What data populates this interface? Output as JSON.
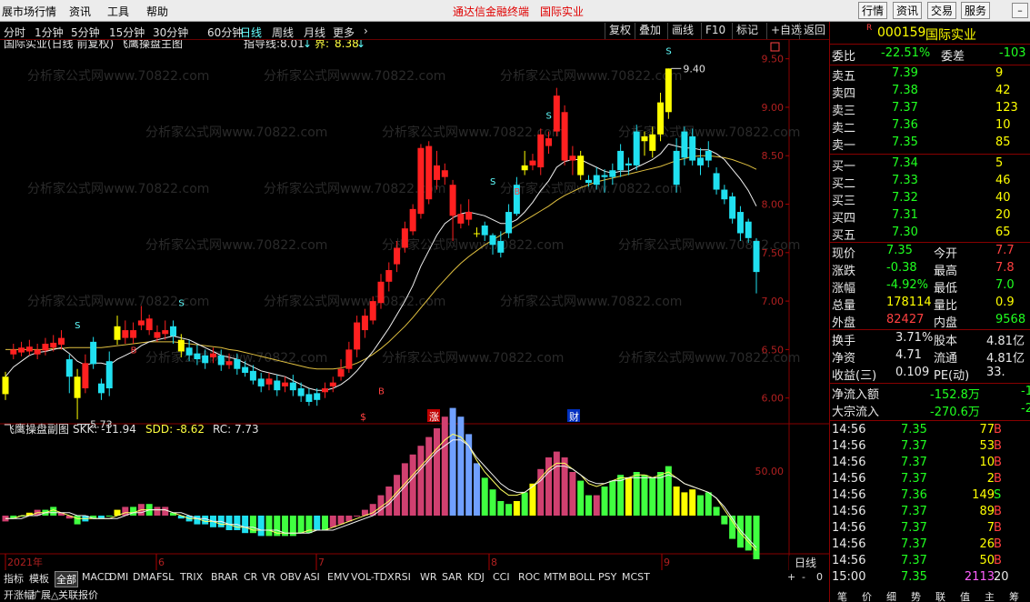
{
  "menubar": {
    "title": "展市场行情",
    "items": [
      "资讯",
      "工具",
      "帮助"
    ],
    "center": "通达信金融终端",
    "center_name": "国际实业",
    "right_buttons": [
      "行情",
      "资讯",
      "交易",
      "服务"
    ]
  },
  "periods": [
    "分时",
    "1分钟",
    "5分钟",
    "15分钟",
    "30分钟",
    "60分钟",
    "日线",
    "周线",
    "月线",
    "更多"
  ],
  "active_period": "日线",
  "tools": [
    "复权",
    "叠加",
    "画线",
    "F10",
    "标记",
    "+自选",
    "返回"
  ],
  "main": {
    "title": "国际实业(日线 前复权) 飞鹰操盘主图",
    "guide_label": "指导线:",
    "guide_value": "8.01",
    "bound_label": "界:",
    "bound_value": "8.38"
  },
  "sub": {
    "title": "飞鹰操盘副图",
    "skk": "SKK: -11.94",
    "sdd": "SDD: -8.62",
    "rc": "RC: 7.73",
    "level": "50.00"
  },
  "date_labels": [
    "2021年",
    "6",
    "7",
    "8",
    "9"
  ],
  "period_tag": "日线",
  "signals": [
    "$",
    "涨",
    "财"
  ],
  "markers": {
    "s": "S",
    "b": "B",
    "high": "9.40",
    "low": "5.73"
  },
  "watermark": "分析家公式网www.70822.com",
  "chart_data": {
    "type": "candlestick",
    "ylim": [
      5.8,
      9.6
    ],
    "yticks": [
      "9.50",
      "9.00",
      "8.50",
      "8.00",
      "7.50",
      "7.00",
      "6.50",
      "6.00"
    ],
    "high_label": 9.4,
    "low_label": 5.73,
    "candles": [
      [
        6.22,
        6.04,
        6.27,
        5.98,
        "y"
      ],
      [
        6.5,
        6.45,
        6.56,
        6.4,
        "r"
      ],
      [
        6.47,
        6.52,
        6.58,
        6.43,
        "r"
      ],
      [
        6.53,
        6.48,
        6.6,
        6.44,
        "r"
      ],
      [
        6.45,
        6.5,
        6.56,
        6.4,
        "r"
      ],
      [
        6.49,
        6.56,
        6.62,
        6.44,
        "r"
      ],
      [
        6.57,
        6.52,
        6.65,
        6.48,
        "r"
      ],
      [
        6.55,
        6.62,
        6.7,
        6.5,
        "r"
      ],
      [
        6.4,
        6.22,
        6.45,
        6.05,
        "c"
      ],
      [
        6.22,
        6.0,
        6.3,
        5.78,
        "y"
      ],
      [
        6.1,
        6.36,
        6.45,
        6.05,
        "r"
      ],
      [
        6.58,
        6.35,
        6.63,
        6.3,
        "c"
      ],
      [
        6.05,
        6.15,
        6.2,
        5.98,
        "c"
      ],
      [
        6.38,
        6.1,
        6.48,
        6.02,
        "c"
      ],
      [
        6.6,
        6.74,
        6.85,
        6.55,
        "y"
      ],
      [
        6.7,
        6.62,
        6.8,
        6.56,
        "r"
      ],
      [
        6.62,
        6.7,
        6.78,
        6.56,
        "r"
      ],
      [
        6.75,
        6.8,
        6.95,
        6.7,
        "r"
      ],
      [
        6.82,
        6.7,
        6.86,
        6.65,
        "r"
      ],
      [
        6.68,
        6.62,
        6.75,
        6.58,
        "r"
      ],
      [
        6.66,
        6.7,
        6.8,
        6.6,
        "r"
      ],
      [
        6.74,
        6.64,
        6.8,
        6.56,
        "c"
      ],
      [
        6.6,
        6.48,
        6.66,
        6.42,
        "y"
      ],
      [
        6.52,
        6.44,
        6.6,
        6.38,
        "c"
      ],
      [
        6.46,
        6.4,
        6.55,
        6.34,
        "c"
      ],
      [
        6.44,
        6.36,
        6.5,
        6.3,
        "c"
      ],
      [
        6.42,
        6.46,
        6.52,
        6.36,
        "r"
      ],
      [
        6.44,
        6.34,
        6.5,
        6.28,
        "c"
      ],
      [
        6.34,
        6.38,
        6.46,
        6.3,
        "r"
      ],
      [
        6.4,
        6.3,
        6.46,
        6.24,
        "c"
      ],
      [
        6.32,
        6.26,
        6.38,
        6.22,
        "c"
      ],
      [
        6.28,
        6.18,
        6.34,
        6.14,
        "c"
      ],
      [
        6.2,
        6.12,
        6.26,
        6.06,
        "c"
      ],
      [
        6.14,
        6.2,
        6.26,
        6.08,
        "r"
      ],
      [
        6.18,
        6.08,
        6.24,
        6.02,
        "c"
      ],
      [
        6.12,
        6.16,
        6.22,
        6.06,
        "r"
      ],
      [
        6.16,
        6.08,
        6.24,
        6.02,
        "c"
      ],
      [
        6.1,
        6.02,
        6.16,
        5.96,
        "c"
      ],
      [
        6.04,
        5.96,
        6.1,
        5.92,
        "c"
      ],
      [
        5.98,
        6.05,
        6.1,
        5.92,
        "c"
      ],
      [
        6.06,
        6.1,
        6.16,
        6.0,
        "r"
      ],
      [
        6.12,
        6.16,
        6.22,
        6.06,
        "r"
      ],
      [
        6.22,
        6.3,
        6.4,
        6.18,
        "r"
      ],
      [
        6.3,
        6.5,
        6.58,
        6.26,
        "r"
      ],
      [
        6.5,
        6.78,
        6.85,
        6.42,
        "r"
      ],
      [
        6.7,
        6.85,
        6.92,
        6.62,
        "r"
      ],
      [
        6.8,
        7.0,
        7.05,
        6.76,
        "r"
      ],
      [
        6.98,
        7.2,
        7.28,
        6.92,
        "r"
      ],
      [
        7.2,
        7.32,
        7.4,
        7.1,
        "r"
      ],
      [
        7.38,
        7.55,
        7.62,
        7.3,
        "r"
      ],
      [
        7.55,
        7.75,
        7.82,
        7.5,
        "r"
      ],
      [
        7.72,
        7.95,
        8.0,
        7.68,
        "r"
      ],
      [
        7.9,
        8.58,
        8.62,
        7.85,
        "r"
      ],
      [
        8.6,
        8.05,
        8.65,
        8.0,
        "r"
      ],
      [
        8.25,
        8.4,
        8.55,
        8.15,
        "r"
      ],
      [
        8.35,
        8.28,
        8.42,
        8.2,
        "r"
      ],
      [
        8.2,
        7.88,
        8.25,
        7.62,
        "r"
      ],
      [
        7.9,
        7.8,
        8.0,
        7.75,
        "r"
      ],
      [
        7.84,
        7.92,
        8.05,
        7.78,
        "r"
      ],
      [
        7.7,
        7.7,
        7.76,
        7.66,
        "y"
      ],
      [
        7.78,
        7.68,
        7.82,
        7.62,
        "c"
      ],
      [
        7.68,
        7.58,
        7.7,
        7.48,
        "c"
      ],
      [
        7.5,
        7.62,
        7.72,
        7.45,
        "c"
      ],
      [
        7.7,
        7.92,
        8.0,
        7.65,
        "c"
      ],
      [
        7.9,
        8.2,
        8.28,
        7.88,
        "c"
      ],
      [
        8.4,
        8.35,
        8.55,
        8.3,
        "y"
      ],
      [
        8.4,
        8.45,
        8.52,
        8.35,
        "r"
      ],
      [
        8.38,
        8.72,
        8.78,
        8.3,
        "r"
      ],
      [
        8.6,
        8.68,
        8.75,
        8.52,
        "r"
      ],
      [
        8.75,
        9.12,
        9.2,
        8.7,
        "r"
      ],
      [
        8.95,
        8.45,
        9.02,
        8.4,
        "r"
      ],
      [
        8.45,
        8.5,
        8.6,
        8.3,
        "r"
      ],
      [
        8.5,
        8.3,
        8.55,
        8.25,
        "y"
      ],
      [
        8.25,
        8.22,
        8.3,
        8.18,
        "c"
      ],
      [
        8.2,
        8.3,
        8.38,
        8.15,
        "c"
      ],
      [
        8.28,
        8.3,
        8.36,
        8.12,
        "c"
      ],
      [
        8.35,
        8.28,
        8.42,
        8.2,
        "c"
      ],
      [
        8.35,
        8.55,
        8.62,
        8.28,
        "c"
      ],
      [
        8.4,
        8.42,
        8.48,
        8.3,
        "c"
      ],
      [
        8.4,
        8.75,
        8.82,
        8.35,
        "c"
      ],
      [
        8.65,
        8.7,
        8.75,
        8.5,
        "y"
      ],
      [
        8.55,
        8.72,
        8.8,
        8.48,
        "y"
      ],
      [
        8.72,
        9.05,
        9.15,
        8.65,
        "y"
      ],
      [
        8.95,
        9.4,
        9.4,
        8.88,
        "y"
      ],
      [
        8.55,
        8.2,
        8.68,
        8.12,
        "c"
      ],
      [
        8.75,
        8.48,
        8.8,
        8.4,
        "c"
      ],
      [
        8.45,
        8.7,
        8.78,
        8.4,
        "c"
      ],
      [
        8.4,
        8.48,
        8.58,
        8.3,
        "c"
      ],
      [
        8.45,
        8.55,
        8.65,
        8.38,
        "c"
      ],
      [
        8.32,
        8.15,
        8.38,
        8.1,
        "c"
      ],
      [
        8.15,
        8.05,
        8.2,
        8.0,
        "c"
      ],
      [
        8.08,
        7.85,
        8.12,
        7.8,
        "c"
      ],
      [
        7.92,
        7.7,
        7.98,
        7.62,
        "c"
      ],
      [
        7.82,
        7.65,
        7.85,
        7.6,
        "c"
      ],
      [
        7.62,
        7.3,
        7.65,
        7.08,
        "c"
      ]
    ],
    "ma": [
      6.22,
      6.32,
      6.38,
      6.44,
      6.47,
      6.48,
      6.5,
      6.52,
      6.46,
      6.38,
      6.34,
      6.36,
      6.36,
      6.34,
      6.4,
      6.44,
      6.48,
      6.54,
      6.58,
      6.6,
      6.62,
      6.64,
      6.62,
      6.6,
      6.56,
      6.52,
      6.48,
      6.44,
      6.42,
      6.4,
      6.36,
      6.32,
      6.28,
      6.26,
      6.24,
      6.22,
      6.18,
      6.14,
      6.1,
      6.08,
      6.08,
      6.1,
      6.14,
      6.2,
      6.28,
      6.38,
      6.48,
      6.6,
      6.72,
      6.86,
      7.0,
      7.16,
      7.36,
      7.52,
      7.68,
      7.8,
      7.86,
      7.9,
      7.92,
      7.9,
      7.88,
      7.84,
      7.8,
      7.8,
      7.84,
      7.92,
      8.02,
      8.14,
      8.24,
      8.38,
      8.44,
      8.46,
      8.46,
      8.42,
      8.38,
      8.34,
      8.32,
      8.34,
      8.34,
      8.38,
      8.42,
      8.46,
      8.52,
      8.62,
      8.6,
      8.58,
      8.58,
      8.56,
      8.56,
      8.52,
      8.46,
      8.36,
      8.26,
      8.14,
      7.98
    ],
    "ma_long": [
      6.5,
      6.5,
      6.5,
      6.5,
      6.5,
      6.5,
      6.51,
      6.51,
      6.52,
      6.52,
      6.52,
      6.52,
      6.52,
      6.53,
      6.54,
      6.55,
      6.56,
      6.57,
      6.58,
      6.58,
      6.58,
      6.58,
      6.57,
      6.56,
      6.55,
      6.54,
      6.53,
      6.52,
      6.5,
      6.49,
      6.47,
      6.45,
      6.43,
      6.41,
      6.39,
      6.37,
      6.35,
      6.33,
      6.31,
      6.3,
      6.3,
      6.3,
      6.31,
      6.33,
      6.36,
      6.4,
      6.45,
      6.51,
      6.58,
      6.66,
      6.74,
      6.83,
      6.93,
      7.03,
      7.13,
      7.22,
      7.31,
      7.39,
      7.46,
      7.52,
      7.58,
      7.63,
      7.68,
      7.73,
      7.78,
      7.83,
      7.88,
      7.93,
      7.98,
      8.04,
      8.09,
      8.13,
      8.17,
      8.2,
      8.23,
      8.25,
      8.27,
      8.29,
      8.31,
      8.33,
      8.35,
      8.37,
      8.39,
      8.42,
      8.45,
      8.47,
      8.49,
      8.5,
      8.5,
      8.49,
      8.48,
      8.46,
      8.43,
      8.4,
      8.36
    ],
    "osc": [
      -2,
      -1,
      0,
      1,
      2,
      2,
      3,
      1,
      -1,
      -3,
      -2,
      -1,
      -1,
      0,
      2,
      3,
      3,
      4,
      4,
      3,
      3,
      1,
      -1,
      -2,
      -3,
      -3,
      -4,
      -4,
      -5,
      -5,
      -6,
      -6,
      -7,
      -7,
      -7,
      -7,
      -7,
      -6,
      -6,
      -5,
      -5,
      -4,
      -3,
      -2,
      0,
      2,
      4,
      7,
      10,
      14,
      18,
      21,
      24,
      27,
      30,
      34,
      37,
      34,
      28,
      18,
      13,
      9,
      5,
      4,
      5,
      8,
      11,
      16,
      20,
      22,
      20,
      15,
      12,
      7,
      7,
      10,
      12,
      14,
      13,
      15,
      14,
      13,
      15,
      17,
      10,
      8,
      9,
      7,
      8,
      3,
      -3,
      -8,
      -11,
      -12,
      -15
    ],
    "osc_colors": "mggymggmmgcgcgymgmgmmgcccccccccgcggggggcgmmmmmmmmmmmmmmmbbbbggggygymmmmmggmgggygggggyyyggggggggg",
    "osc_line": [
      -1,
      -1,
      0,
      0,
      1,
      1,
      2,
      1,
      0,
      -1,
      -1,
      -1,
      -1,
      -1,
      0,
      1,
      1,
      2,
      2,
      2,
      2,
      1,
      0,
      -1,
      -1,
      -2,
      -2,
      -3,
      -3,
      -4,
      -4,
      -5,
      -5,
      -5,
      -6,
      -6,
      -6,
      -6,
      -5,
      -5,
      -5,
      -4,
      -3,
      -2,
      -1,
      0,
      1,
      3,
      5,
      8,
      11,
      14,
      17,
      20,
      23,
      26,
      28,
      27,
      24,
      19,
      15,
      12,
      9,
      7,
      7,
      8,
      10,
      13,
      16,
      18,
      18,
      16,
      14,
      11,
      10,
      11,
      12,
      13,
      13,
      14,
      14,
      13,
      14,
      15,
      13,
      11,
      10,
      9,
      8,
      6,
      2,
      -2,
      -6,
      -9,
      -12
    ],
    "osc_line2": [
      -1,
      -1,
      -1,
      0,
      0,
      1,
      1,
      1,
      1,
      0,
      0,
      -1,
      -1,
      -1,
      -1,
      0,
      1,
      1,
      2,
      2,
      2,
      1,
      1,
      0,
      -1,
      -1,
      -2,
      -2,
      -3,
      -3,
      -4,
      -4,
      -5,
      -5,
      -5,
      -6,
      -6,
      -6,
      -6,
      -5,
      -5,
      -5,
      -4,
      -3,
      -2,
      -1,
      0,
      2,
      4,
      7,
      10,
      13,
      16,
      19,
      22,
      24,
      26,
      26,
      24,
      20,
      17,
      14,
      11,
      9,
      8,
      8,
      10,
      12,
      15,
      17,
      17,
      16,
      14,
      12,
      11,
      11,
      12,
      12,
      13,
      13,
      13,
      13,
      13,
      14,
      13,
      11,
      10,
      9,
      8,
      6,
      3,
      -1,
      -5,
      -8,
      -11
    ]
  },
  "quote": {
    "code": "000159",
    "name": "国际实业",
    "ratio_label": "委比",
    "ratio": "-22.51%",
    "diff_label": "委差",
    "diff": "-103",
    "asks": [
      [
        "卖五",
        "7.39",
        "9"
      ],
      [
        "卖四",
        "7.38",
        "42"
      ],
      [
        "卖三",
        "7.37",
        "123"
      ],
      [
        "卖二",
        "7.36",
        "10"
      ],
      [
        "卖一",
        "7.35",
        "85"
      ]
    ],
    "bids": [
      [
        "买一",
        "7.34",
        "5"
      ],
      [
        "买二",
        "7.33",
        "46"
      ],
      [
        "买三",
        "7.32",
        "40"
      ],
      [
        "买四",
        "7.31",
        "20"
      ],
      [
        "买五",
        "7.30",
        "65"
      ]
    ],
    "stats": [
      [
        "现价",
        "7.35",
        "今开",
        "7.7"
      ],
      [
        "涨跌",
        "-0.38",
        "最高",
        "7.8"
      ],
      [
        "涨幅",
        "-4.92%",
        "最低",
        "7.0"
      ],
      [
        "总量",
        "178114",
        "量比",
        "0.9"
      ],
      [
        "外盘",
        "82427",
        "内盘",
        "9568"
      ]
    ],
    "stats2": [
      [
        "换手",
        "3.71%",
        "股本",
        "4.81亿"
      ],
      [
        "净资",
        "4.71",
        "流通",
        "4.81亿"
      ],
      [
        "收益(三)",
        "0.109",
        "PE(动)",
        "33."
      ]
    ],
    "flows": [
      [
        "净流入额",
        "-152.8万",
        "-1"
      ],
      [
        "大宗流入",
        "-270.6万",
        "-2"
      ]
    ],
    "ticks": [
      [
        "14:56",
        "7.35",
        "77",
        "B"
      ],
      [
        "14:56",
        "7.37",
        "53",
        "B"
      ],
      [
        "14:56",
        "7.37",
        "10",
        "B"
      ],
      [
        "14:56",
        "7.37",
        "2",
        "B"
      ],
      [
        "14:56",
        "7.36",
        "149",
        "S"
      ],
      [
        "14:56",
        "7.37",
        "89",
        "B"
      ],
      [
        "14:56",
        "7.37",
        "7",
        "B"
      ],
      [
        "14:56",
        "7.37",
        "26",
        "B"
      ],
      [
        "14:56",
        "7.37",
        "50",
        "B"
      ],
      [
        "15:00",
        "7.35",
        "2113",
        "20"
      ]
    ]
  },
  "indicators": [
    "指标",
    "模板",
    "全部",
    "MACD",
    "DMI",
    "DMA",
    "FSL",
    "TRIX",
    "BRAR",
    "CR",
    "VR",
    "OBV",
    "ASI",
    "EMV",
    "VOL-TDX",
    "RSI",
    "WR",
    "SAR",
    "KDJ",
    "CCI",
    "ROC",
    "MTM",
    "BOLL",
    "PSY",
    "MCST"
  ],
  "bottom_tabs": [
    "开涨幅",
    "扩展△",
    "关联报价"
  ],
  "right_bottom_tabs": [
    "笔",
    "价",
    "细",
    "势",
    "联",
    "值",
    "主",
    "筹"
  ]
}
